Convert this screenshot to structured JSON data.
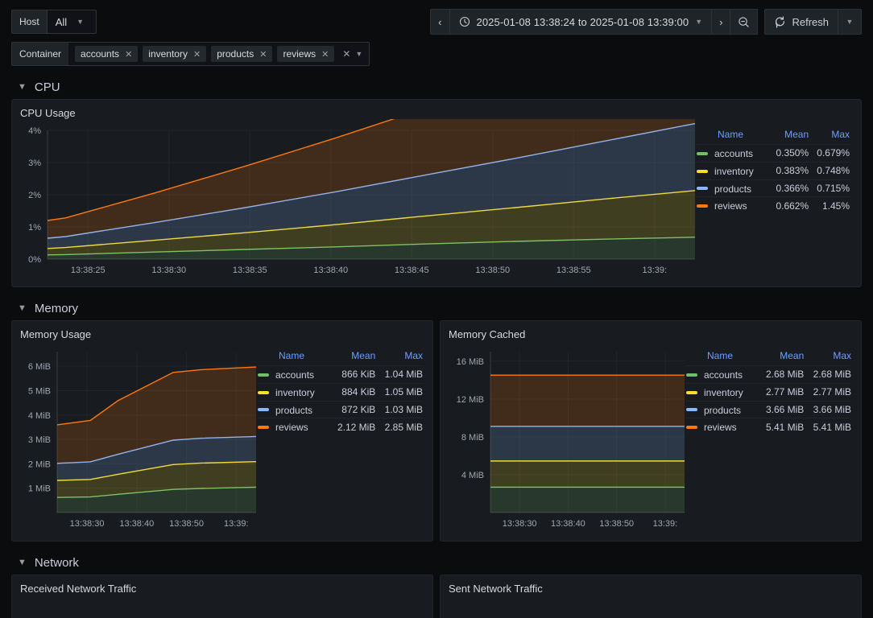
{
  "topbar": {
    "host_var": {
      "label": "Host",
      "value": "All"
    },
    "container_var": {
      "label": "Container",
      "chips": [
        "accounts",
        "inventory",
        "products",
        "reviews"
      ],
      "remove_icon": "✕",
      "clear_icon": "✕"
    },
    "time": {
      "prev_icon": "‹",
      "next_icon": "›",
      "clock_icon": "clock",
      "range": "2025-01-08 13:38:24 to 2025-01-08 13:39:00",
      "zoom_out_icon": "zoom-out"
    },
    "refresh": {
      "label": "Refresh",
      "icon": "refresh"
    }
  },
  "rows": [
    {
      "title": "CPU"
    },
    {
      "title": "Memory"
    },
    {
      "title": "Network"
    }
  ],
  "legend_headers": {
    "name": "Name",
    "mean": "Mean",
    "max": "Max"
  },
  "colors": {
    "accounts": "#73bf69",
    "inventory": "#fade2a",
    "products": "#8ab8ff",
    "reviews": "#ff780a",
    "panel_bg": "#181b1f",
    "page_bg": "#0b0c0e",
    "accent": "#6e9fff"
  },
  "panels": {
    "cpu_usage": {
      "title": "CPU Usage",
      "legend": [
        {
          "name": "accounts",
          "mean": "0.350%",
          "max": "0.679%"
        },
        {
          "name": "inventory",
          "mean": "0.383%",
          "max": "0.748%"
        },
        {
          "name": "products",
          "mean": "0.366%",
          "max": "0.715%"
        },
        {
          "name": "reviews",
          "mean": "0.662%",
          "max": "1.45%"
        }
      ]
    },
    "memory_usage": {
      "title": "Memory Usage",
      "legend": [
        {
          "name": "accounts",
          "mean": "866 KiB",
          "max": "1.04 MiB"
        },
        {
          "name": "inventory",
          "mean": "884 KiB",
          "max": "1.05 MiB"
        },
        {
          "name": "products",
          "mean": "872 KiB",
          "max": "1.03 MiB"
        },
        {
          "name": "reviews",
          "mean": "2.12 MiB",
          "max": "2.85 MiB"
        }
      ]
    },
    "memory_cached": {
      "title": "Memory Cached",
      "legend": [
        {
          "name": "accounts",
          "mean": "2.68 MiB",
          "max": "2.68 MiB"
        },
        {
          "name": "inventory",
          "mean": "2.77 MiB",
          "max": "2.77 MiB"
        },
        {
          "name": "products",
          "mean": "3.66 MiB",
          "max": "3.66 MiB"
        },
        {
          "name": "reviews",
          "mean": "5.41 MiB",
          "max": "5.41 MiB"
        }
      ]
    },
    "received_network_traffic": {
      "title": "Received Network Traffic"
    },
    "sent_network_traffic": {
      "title": "Sent Network Traffic"
    }
  },
  "chart_data": [
    {
      "id": "cpu_usage",
      "type": "line",
      "title": "CPU Usage",
      "xlabel": "",
      "ylabel": "",
      "ytick_labels": [
        "0%",
        "1%",
        "2%",
        "3%",
        "4%"
      ],
      "ylim": [
        0,
        4
      ],
      "xtick_labels": [
        "13:38:25",
        "13:38:30",
        "13:38:35",
        "13:38:40",
        "13:38:45",
        "13:38:50",
        "13:38:55",
        "13:39:"
      ],
      "x": [
        24,
        25,
        30,
        35,
        40,
        45,
        50,
        55,
        60
      ],
      "series": [
        {
          "name": "accounts",
          "color": "#73bf69",
          "values": [
            0.13,
            0.14,
            0.22,
            0.3,
            0.38,
            0.47,
            0.55,
            0.62,
            0.68
          ]
        },
        {
          "name": "inventory",
          "color": "#fade2a",
          "values": [
            0.2,
            0.22,
            0.37,
            0.52,
            0.69,
            0.87,
            1.05,
            1.25,
            1.45
          ]
        },
        {
          "name": "products",
          "color": "#8ab8ff",
          "values": [
            0.32,
            0.34,
            0.55,
            0.78,
            1.02,
            1.27,
            1.53,
            1.8,
            2.08
          ]
        },
        {
          "name": "reviews",
          "color": "#ff780a",
          "values": [
            0.55,
            0.58,
            0.92,
            1.29,
            1.67,
            2.07,
            2.48,
            2.92,
            3.4
          ]
        }
      ],
      "grid": true,
      "legend_position": "right"
    },
    {
      "id": "memory_usage",
      "type": "area",
      "stacked": true,
      "title": "Memory Usage",
      "ytick_labels": [
        "1 MiB",
        "2 MiB",
        "3 MiB",
        "4 MiB",
        "5 MiB",
        "6 MiB"
      ],
      "ylim": [
        0,
        6.6
      ],
      "xtick_labels": [
        "13:38:30",
        "13:38:40",
        "13:38:50",
        "13:39:"
      ],
      "x": [
        24,
        30,
        35,
        45,
        50,
        60
      ],
      "series": [
        {
          "name": "accounts",
          "color": "#73bf69",
          "values": [
            0.62,
            0.64,
            0.75,
            0.95,
            0.99,
            1.04
          ]
        },
        {
          "name": "inventory",
          "color": "#fade2a",
          "values": [
            0.7,
            0.72,
            0.82,
            1.02,
            1.04,
            1.05
          ]
        },
        {
          "name": "products",
          "color": "#8ab8ff",
          "values": [
            0.7,
            0.72,
            0.82,
            1.0,
            1.02,
            1.03
          ]
        },
        {
          "name": "reviews",
          "color": "#ff780a",
          "values": [
            1.58,
            1.7,
            2.2,
            2.78,
            2.81,
            2.85
          ]
        }
      ],
      "grid": true,
      "legend_position": "right"
    },
    {
      "id": "memory_cached",
      "type": "area",
      "stacked": true,
      "title": "Memory Cached",
      "ytick_labels": [
        "4 MiB",
        "8 MiB",
        "12 MiB",
        "16 MiB"
      ],
      "ylim": [
        0,
        17
      ],
      "xtick_labels": [
        "13:38:30",
        "13:38:40",
        "13:38:50",
        "13:39:"
      ],
      "x": [
        24,
        60
      ],
      "series": [
        {
          "name": "accounts",
          "color": "#73bf69",
          "values": [
            2.68,
            2.68
          ]
        },
        {
          "name": "inventory",
          "color": "#fade2a",
          "values": [
            2.77,
            2.77
          ]
        },
        {
          "name": "products",
          "color": "#8ab8ff",
          "values": [
            3.66,
            3.66
          ]
        },
        {
          "name": "reviews",
          "color": "#ff780a",
          "values": [
            5.41,
            5.41
          ]
        }
      ],
      "grid": true,
      "legend_position": "right"
    }
  ]
}
